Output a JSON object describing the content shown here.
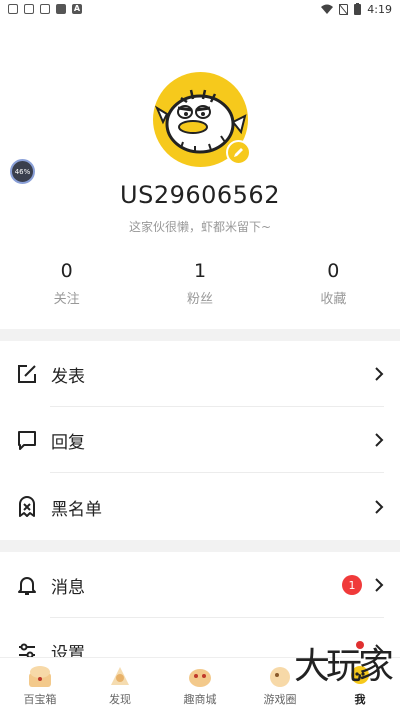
{
  "statusbar": {
    "time": "4:19"
  },
  "profile": {
    "username": "US29606562",
    "bio": "这家伙很懒，虾都米留下~",
    "progress": "46%"
  },
  "stats": [
    {
      "value": "0",
      "label": "关注"
    },
    {
      "value": "1",
      "label": "粉丝"
    },
    {
      "value": "0",
      "label": "收藏"
    }
  ],
  "menu": {
    "post": "发表",
    "reply": "回复",
    "blacklist": "黑名单",
    "messages": "消息",
    "messages_badge": "1",
    "settings": "设置"
  },
  "tabs": [
    {
      "label": "百宝箱"
    },
    {
      "label": "发现"
    },
    {
      "label": "趣商城"
    },
    {
      "label": "游戏圈"
    },
    {
      "label": "我"
    }
  ],
  "watermark": "大玩家",
  "colors": {
    "accent": "#f6c91c",
    "badge": "#f03a3a"
  }
}
